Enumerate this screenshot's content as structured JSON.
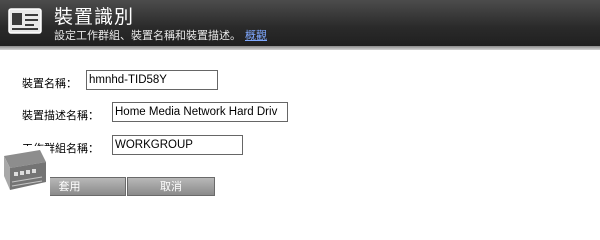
{
  "header": {
    "title": "裝置識別",
    "subtitle": "設定工作群組、裝置名稱和裝置描述。",
    "overview_link": "概觀"
  },
  "form": {
    "device_name": {
      "label": "裝置名稱：",
      "value": "hmnhd-TID58Y"
    },
    "device_description": {
      "label": "裝置描述名稱：",
      "value": "Home Media Network Hard Driv"
    },
    "workgroup": {
      "label": "工作群組名稱：",
      "value": "WORKGROUP"
    }
  },
  "buttons": {
    "apply_label": "套用",
    "cancel_label": "取消"
  },
  "icons": {
    "header_icon": "device-id-card-icon",
    "corner_decoration": "network-device-graphic"
  }
}
